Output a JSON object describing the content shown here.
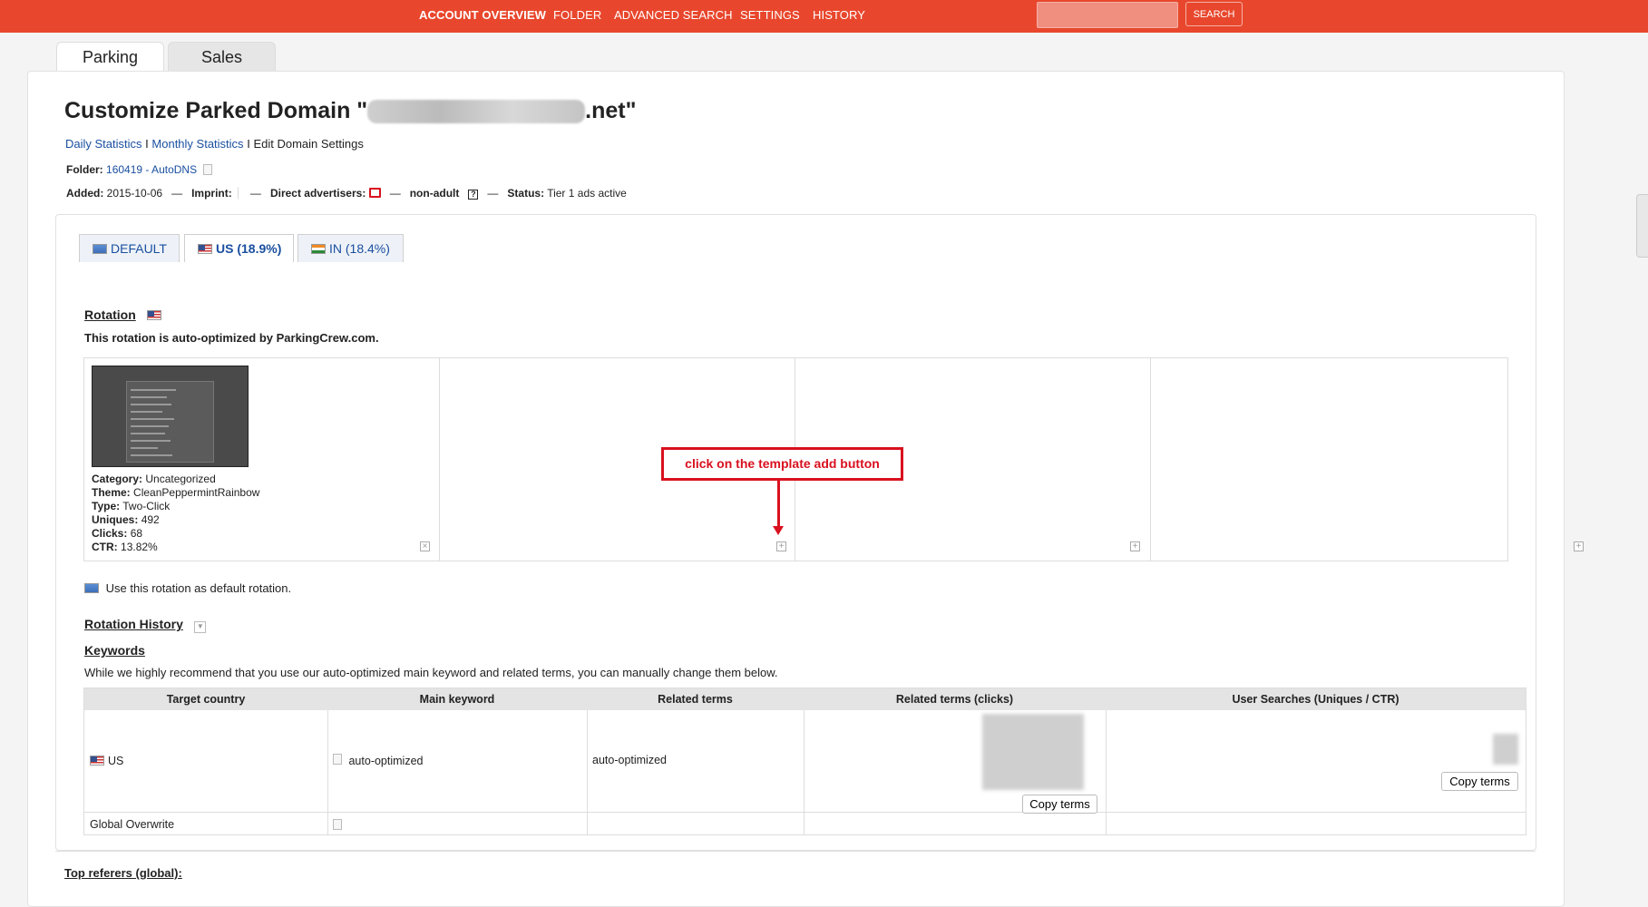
{
  "nav": {
    "items": [
      "ACCOUNT OVERVIEW",
      "FOLDER",
      "ADVANCED SEARCH",
      "SETTINGS",
      "HISTORY"
    ],
    "search_button": "SEARCH",
    "search_value": ""
  },
  "main_tabs": [
    {
      "label": "Parking",
      "active": true
    },
    {
      "label": "Sales",
      "active": false
    }
  ],
  "page": {
    "title_prefix": "Customize Parked Domain \"",
    "title_suffix": ".net\"",
    "links": [
      "Daily Statistics",
      "Monthly Statistics",
      "Edit Domain Settings"
    ],
    "separator": "I",
    "folder_label": "Folder:",
    "folder_value": "160419 - AutoDNS",
    "added_label": "Added:",
    "added_value": "2015-10-06",
    "dash": "—",
    "imprint_label": "Imprint:",
    "direct_label": "Direct advertisers:",
    "nonadult_label": "non-adult",
    "status_label": "Status:",
    "status_value": "Tier 1 ads active"
  },
  "country_tabs": [
    {
      "label": "DEFAULT",
      "flag": "default-flag",
      "active": false
    },
    {
      "label": "US (18.9%)",
      "flag": "us-flag",
      "active": true
    },
    {
      "label": "IN (18.4%)",
      "flag": "in-flag",
      "active": false
    }
  ],
  "rotation": {
    "heading": "Rotation",
    "note": "This rotation is auto-optimized by ParkingCrew.com.",
    "template": {
      "category_label": "Category:",
      "category": "Uncategorized",
      "theme_label": "Theme:",
      "theme": "CleanPeppermintRainbow",
      "type_label": "Type:",
      "type": "Two-Click",
      "uniques_label": "Uniques:",
      "uniques": "492",
      "clicks_label": "Clicks:",
      "clicks": "68",
      "ctr_label": "CTR:",
      "ctr": "13.82%"
    },
    "callout": "click on the template add button",
    "default_text": "Use this rotation as default rotation.",
    "history_heading": "Rotation History"
  },
  "keywords": {
    "heading": "Keywords",
    "intro": "While we highly recommend that you use our auto-optimized main keyword and related terms, you can manually change them below.",
    "columns": [
      "Target country",
      "Main keyword",
      "Related terms",
      "Related terms (clicks)",
      "User Searches (Uniques / CTR)"
    ],
    "rows": [
      {
        "country": "US",
        "main": "auto-optimized",
        "related": "auto-optimized"
      },
      {
        "country": "Global Overwrite",
        "main": "",
        "related": ""
      }
    ],
    "copy_label": "Copy terms"
  },
  "referers_heading": "Top referers (global):"
}
